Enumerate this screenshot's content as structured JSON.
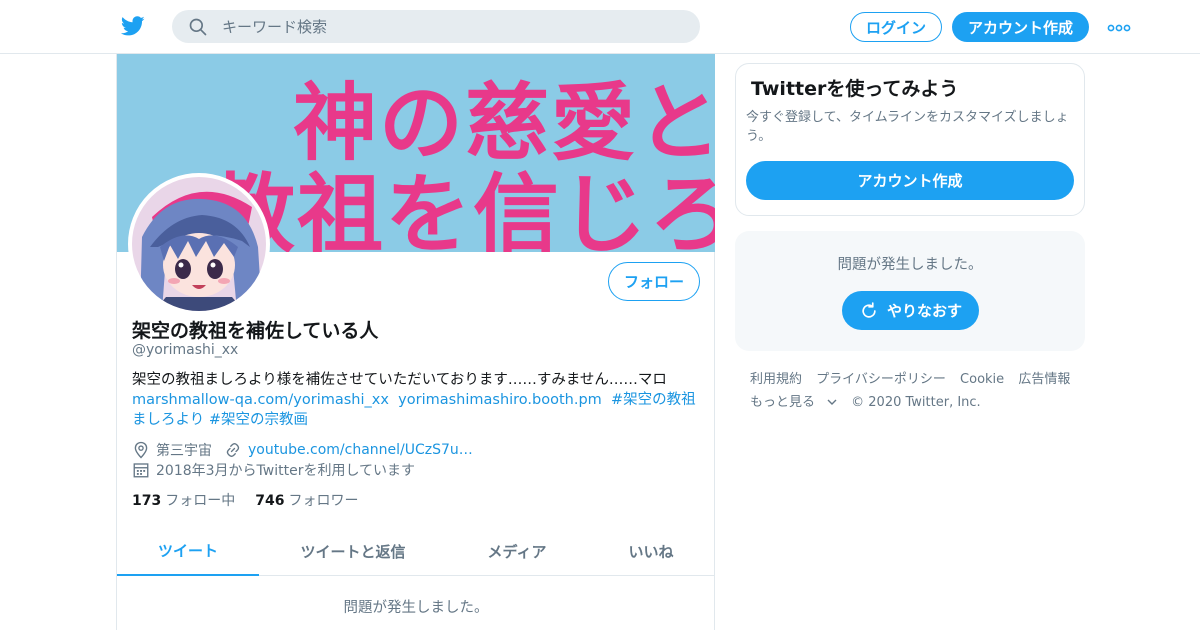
{
  "colors": {
    "accent": "#1da1f2",
    "link": "#1b95e0",
    "banner_bg": "#8bcbe6",
    "banner_text": "#e8398a",
    "muted": "#657786"
  },
  "header": {
    "logo_icon": "twitter-bird-icon",
    "search": {
      "placeholder": "キーワード検索",
      "value": ""
    },
    "login_label": "ログイン",
    "signup_label": "アカウント作成",
    "more_icon": "more-dots-icon"
  },
  "profile": {
    "banner_lines": [
      "神の慈愛と",
      "教祖を信じろ"
    ],
    "display_name": "架空の教祖を補佐している人",
    "handle": "@yorimashi_xx",
    "follow_label": "フォロー",
    "bio": {
      "text1": "架空の教祖ましろより様を補佐させていただいております……すみません……マロ",
      "link1": "marshmallow-qa.com/yorimashi_xx",
      "link2": "yorimashimashiro.booth.pm",
      "hashtag1": "#架空の教祖ましろより",
      "hashtag2": "#架空の宗教画"
    },
    "location": "第三宇宙",
    "url": "youtube.com/channel/UCzS7u…",
    "joined": "2018年3月からTwitterを利用しています",
    "following_count": "173",
    "following_label": "フォロー中",
    "followers_count": "746",
    "followers_label": "フォロワー"
  },
  "tabs": [
    {
      "label": "ツイート",
      "active": true
    },
    {
      "label": "ツイートと返信",
      "active": false
    },
    {
      "label": "メディア",
      "active": false
    },
    {
      "label": "いいね",
      "active": false
    }
  ],
  "timeline": {
    "error": "問題が発生しました。"
  },
  "sidebar": {
    "signup": {
      "title": "Twitterを使ってみよう",
      "desc": "今すぐ登録して、タイムラインをカスタマイズしましょう。",
      "button": "アカウント作成"
    },
    "error": {
      "message": "問題が発生しました。",
      "retry": "やりなおす"
    },
    "footer": {
      "terms": "利用規約",
      "privacy": "プライバシーポリシー",
      "cookie": "Cookie",
      "ads": "広告情報",
      "more": "もっと見る",
      "copyright": "© 2020 Twitter, Inc."
    }
  }
}
